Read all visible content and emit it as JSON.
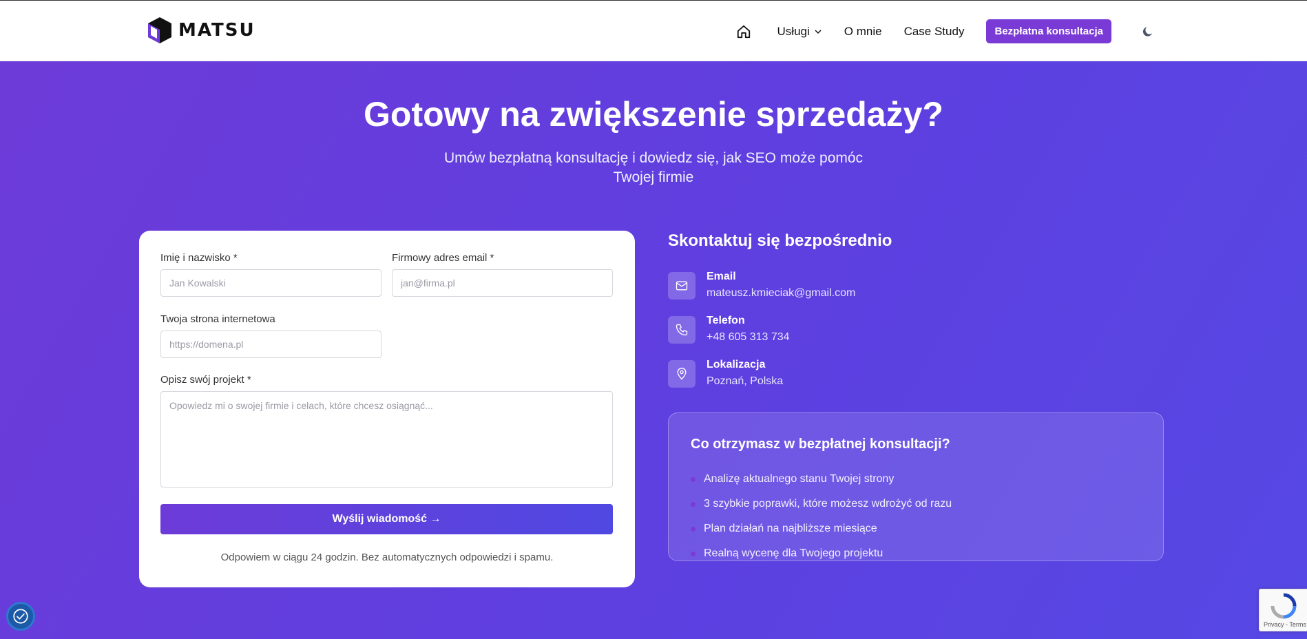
{
  "header": {
    "logo_text": "MATSU",
    "nav": {
      "services": "Usługi",
      "about": "O mnie",
      "case_study": "Case Study",
      "cta": "Bezpłatna konsultacja"
    }
  },
  "hero": {
    "title": "Gotowy na zwiększenie sprzedaży?",
    "subtitle": "Umów bezpłatną konsultację i dowiedz się, jak SEO może pomóc Twojej firmie"
  },
  "form": {
    "name_label": "Imię i nazwisko *",
    "name_placeholder": "Jan Kowalski",
    "email_label": "Firmowy adres email *",
    "email_placeholder": "jan@firma.pl",
    "website_label": "Twoja strona internetowa",
    "website_placeholder": "https://domena.pl",
    "project_label": "Opisz swój projekt *",
    "project_placeholder": "Opowiedz mi o swojej firmie i celach, które chcesz osiągnąć...",
    "submit_label": "Wyślij wiadomość →",
    "note": "Odpowiem w ciągu 24 godzin. Bez automatycznych odpowiedzi i spamu."
  },
  "contact": {
    "title": "Skontaktuj się bezpośrednio",
    "items": [
      {
        "label": "Email",
        "value": "mateusz.kmieciak@gmail.com",
        "icon": "mail-icon"
      },
      {
        "label": "Telefon",
        "value": "+48 605 313 734",
        "icon": "phone-icon"
      },
      {
        "label": "Lokalizacja",
        "value": "Poznań, Polska",
        "icon": "location-pin-icon"
      }
    ]
  },
  "benefits": {
    "title": "Co otrzymasz w bezpłatnej konsultacji?",
    "items": [
      "Analizę aktualnego stanu Twojej strony",
      "3 szybkie poprawki, które możesz wdrożyć od razu",
      "Plan działań na najbliższe miesiące",
      "Realną wycenę dla Twojego projektu"
    ]
  },
  "recaptcha": {
    "links": "Privacy - Terms"
  },
  "colors": {
    "accent": "#7a3ad6",
    "hero_start": "#6d3bd8",
    "hero_end": "#5648e4"
  }
}
